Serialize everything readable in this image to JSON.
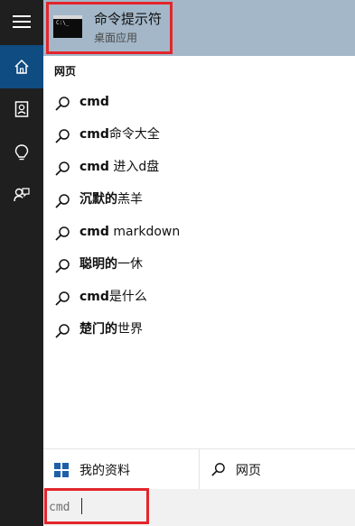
{
  "best_match": {
    "title": "命令提示符",
    "subtitle": "桌面应用",
    "icon_text": "C:\\_",
    "icon": "cmd-icon"
  },
  "section_header": "网页",
  "suggestions": [
    {
      "bold": "cmd",
      "rest": ""
    },
    {
      "bold": "cmd",
      "rest": "命令大全"
    },
    {
      "bold": "cmd",
      "rest": " 进入d盘"
    },
    {
      "bold": "沉默的",
      "rest": "羔羊"
    },
    {
      "bold": "cmd",
      "rest": " markdown"
    },
    {
      "bold": "聪明的",
      "rest": "一休"
    },
    {
      "bold": "cmd",
      "rest": "是什么"
    },
    {
      "bold": "楚门的",
      "rest": "世界"
    }
  ],
  "bottom_bar": {
    "my_stuff_label": "我的资料",
    "web_label": "网页"
  },
  "search": {
    "value": "cmd",
    "placeholder": ""
  },
  "rail_icons": [
    "menu-icon",
    "home-icon",
    "notebook-icon",
    "lightbulb-icon",
    "feedback-icon"
  ],
  "colors": {
    "rail_bg": "#1f1f1f",
    "rail_active": "#0f4c81",
    "best_match_bg": "#a3b7c8",
    "highlight_red": "#e3252b",
    "search_bg": "#f1f1f1"
  }
}
